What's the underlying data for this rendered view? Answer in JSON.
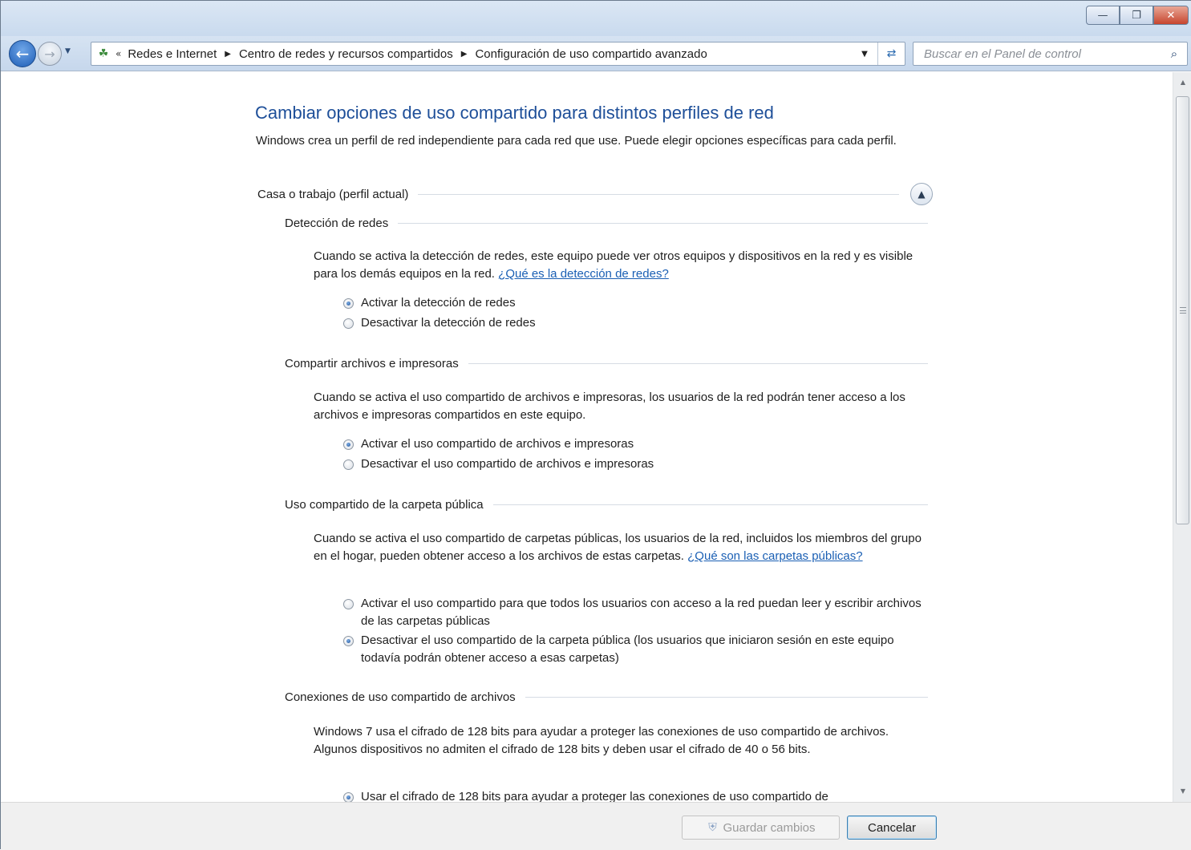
{
  "window": {
    "minimize_label": "—",
    "maximize_label": "❐",
    "close_label": "✕"
  },
  "navigation": {
    "breadcrumb_overflow": "«",
    "breadcrumbs": [
      "Redes e Internet",
      "Centro de redes y recursos compartidos",
      "Configuración de uso compartido avanzado"
    ],
    "search": {
      "placeholder": "Buscar en el Panel de control",
      "value": ""
    }
  },
  "content": {
    "title": "Cambiar opciones de uso compartido para distintos perfiles de red",
    "intro": "Windows crea un perfil de red independiente para cada red que use. Puede elegir opciones específicas para cada perfil.",
    "profile": {
      "name": "Casa o trabajo (perfil actual)",
      "sections": [
        {
          "title": "Detección de redes",
          "description": "Cuando se activa la detección de redes, este equipo puede ver otros equipos y dispositivos en la red y es visible para los demás equipos en la red.",
          "link": "¿Qué es la detección de redes?",
          "options": [
            {
              "label": "Activar la detección de redes",
              "checked": true
            },
            {
              "label": "Desactivar la detección de redes",
              "checked": false
            }
          ]
        },
        {
          "title": "Compartir archivos e impresoras",
          "description": "Cuando se activa el uso compartido de archivos e impresoras, los usuarios de la red podrán tener acceso a los archivos e impresoras compartidos en este equipo.",
          "options": [
            {
              "label": "Activar el uso compartido de archivos e impresoras",
              "checked": true
            },
            {
              "label": "Desactivar el uso compartido de archivos e impresoras",
              "checked": false
            }
          ]
        },
        {
          "title": "Uso compartido de la carpeta pública",
          "description": "Cuando se activa el uso compartido de carpetas públicas, los usuarios de la red, incluidos los miembros del grupo en el hogar, pueden obtener acceso a los archivos de estas carpetas.",
          "link": "¿Qué son las carpetas públicas?",
          "options": [
            {
              "label": "Activar el uso compartido para que todos los usuarios con acceso a la red puedan leer y escribir archivos de las carpetas públicas",
              "checked": false
            },
            {
              "label": "Desactivar el uso compartido de la carpeta pública (los usuarios que iniciaron sesión en este equipo todavía podrán obtener acceso a esas carpetas)",
              "checked": true
            }
          ]
        },
        {
          "title": "Conexiones de uso compartido de archivos",
          "description": "Windows 7 usa el cifrado de 128 bits para ayudar a proteger las conexiones de uso compartido de archivos. Algunos dispositivos no admiten el cifrado de 128 bits y deben usar el cifrado de 40 o 56 bits.",
          "options": [
            {
              "label": "Usar el cifrado de 128 bits para ayudar a proteger las conexiones de uso compartido de",
              "checked": true
            }
          ]
        }
      ]
    }
  },
  "footer": {
    "save_label": "Guardar cambios",
    "cancel_label": "Cancelar"
  },
  "colors": {
    "title_blue": "#1e4f99",
    "link_blue": "#1a5fb4"
  }
}
